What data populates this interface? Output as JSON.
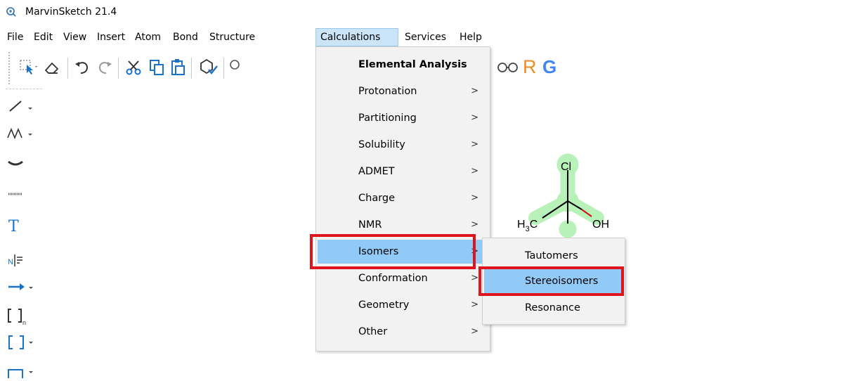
{
  "window": {
    "title": "MarvinSketch 21.4"
  },
  "menubar": {
    "items": [
      "File",
      "Edit",
      "View",
      "Insert",
      "Atom",
      "Bond",
      "Structure",
      "Calculations",
      "Services",
      "Help"
    ],
    "open_menu": "Calculations"
  },
  "calculations_menu": {
    "items": [
      {
        "label": "Elemental Analysis",
        "submenu": false
      },
      {
        "label": "Protonation",
        "submenu": true
      },
      {
        "label": "Partitioning",
        "submenu": true
      },
      {
        "label": "Solubility",
        "submenu": true
      },
      {
        "label": "ADMET",
        "submenu": true
      },
      {
        "label": "Charge",
        "submenu": true
      },
      {
        "label": "NMR",
        "submenu": true
      },
      {
        "label": "Isomers",
        "submenu": true,
        "highlighted": true
      },
      {
        "label": "Conformation",
        "submenu": true
      },
      {
        "label": "Geometry",
        "submenu": true
      },
      {
        "label": "Other",
        "submenu": true
      }
    ]
  },
  "isomers_submenu": {
    "items": [
      {
        "label": "Tautomers"
      },
      {
        "label": "Stereoisomers",
        "highlighted": true
      },
      {
        "label": "Resonance"
      }
    ]
  },
  "molecule": {
    "atoms": {
      "top": "Cl",
      "right": "OH",
      "left_main": "H",
      "left_sub": "3",
      "left_tail": "C"
    }
  },
  "toolbar": {
    "r_label": "R",
    "g_label": "G"
  },
  "left_toolbar": {
    "text_tool": "T",
    "nir_label": "N",
    "bracket_sub": "n"
  },
  "colors": {
    "highlight": "#91c9f7",
    "callout": "#e0141c",
    "accent_blue": "#1a73c7",
    "r_orange": "#f08a24"
  },
  "submenu_arrow": ">"
}
